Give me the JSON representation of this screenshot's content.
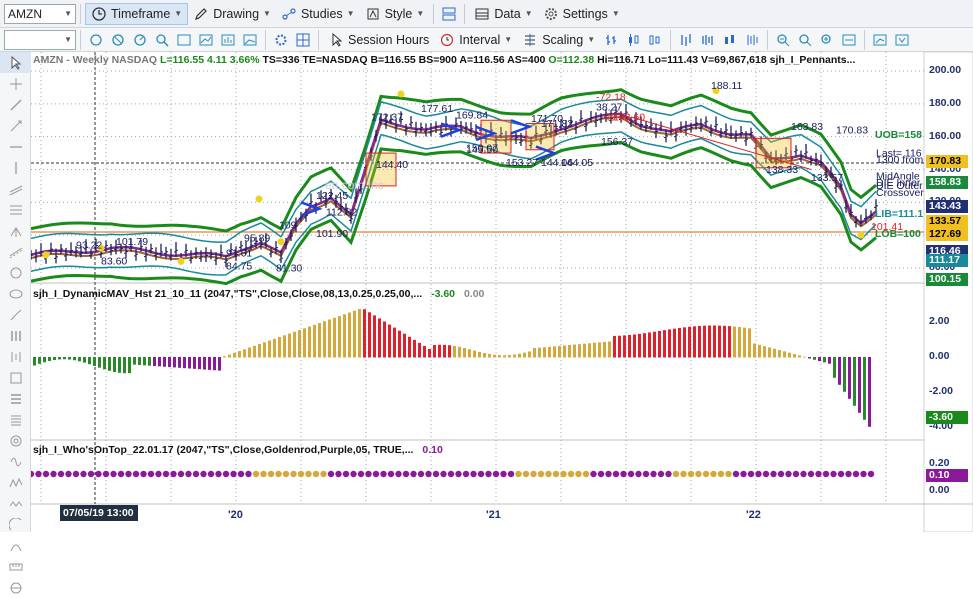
{
  "toolbar": {
    "symbol": "AMZN",
    "timeframe": "Timeframe",
    "drawing": "Drawing",
    "studies": "Studies",
    "style": "Style",
    "data": "Data",
    "settings": "Settings"
  },
  "toolbar2": {
    "session_hours": "Session Hours",
    "interval": "Interval",
    "scaling": "Scaling"
  },
  "price_pane": {
    "title_sym": "AMZN - Weekly  NASDAQ",
    "title_L": "L=116.55",
    "title_chg": "4.11",
    "title_pct": "3.66%",
    "title_rest": "TS=336  TE=NASDAQ  B=116.55  BS=900  A=116.56  AS=400",
    "title_O": "O=112.38",
    "title_rest2": "Hi=116.71  Lo=111.43  V=69,867,618  sjh_I_Pennants...",
    "watermark": "en.com Inc",
    "axis": [
      "200.00",
      "180.00",
      "160.00",
      "140.00",
      "120.00",
      "100.00",
      "80.00"
    ],
    "annotations": [
      "93.22",
      "101.79",
      "83.60",
      "84.75",
      "91.61",
      "95.89",
      "109",
      "122.45",
      "112.82",
      "101.90",
      "81.30",
      "172.37",
      "177.61",
      "169.84",
      "171.70",
      "171.82",
      "150.07",
      "144.40",
      "145.50",
      "153.27",
      "144.06",
      "144.05",
      "156.37",
      "-72.18",
      "38.27",
      "49.76",
      "163.60",
      "188.11",
      "163.83",
      "170.83",
      "138.33",
      "133.57",
      "101.41",
      "MidAngle",
      "DIE Inner",
      "DIE Outer",
      "Crossover",
      "Last= 116",
      "1300 from"
    ],
    "right_tags": [
      {
        "text": "UOB=158",
        "color": "#1a8a3a"
      },
      {
        "text": "LIB=111.1",
        "color": "#1a8a9a"
      },
      {
        "text": "LOB=100",
        "color": "#1a8a3a"
      }
    ],
    "price_tags": [
      {
        "value": "170.83",
        "bg": "#f0c020",
        "fg": "#000"
      },
      {
        "value": "158.83",
        "bg": "#1a8a3a",
        "fg": "#fff"
      },
      {
        "value": "143.43",
        "bg": "#203070",
        "fg": "#fff"
      },
      {
        "value": "133.57",
        "bg": "#f0c020",
        "fg": "#000"
      },
      {
        "value": "127.69",
        "bg": "#f0c020",
        "fg": "#000"
      },
      {
        "value": "116.46",
        "bg": "#203070",
        "fg": "#fff"
      },
      {
        "value": "111.17",
        "bg": "#1a8a9a",
        "fg": "#fff"
      },
      {
        "value": "100.15",
        "bg": "#1a8a3a",
        "fg": "#fff"
      }
    ]
  },
  "mav_pane": {
    "title": "sjh_I_DynamicMAV_Hst 21_10_11 (2047,\"TS\",Close,Close,08,13,0.25,0.25,00,...",
    "value1": "-3.60",
    "value2": "0.00",
    "axis": [
      "2.00",
      "0.00",
      "-2.00",
      "-4.00"
    ],
    "tag": "-3.60"
  },
  "who_pane": {
    "title": "sjh_I_Who'sOnTop_22.01.17 (2047,\"TS\",Close,Goldenrod,Purple,05, TRUE,...",
    "value": "0.10",
    "axis": [
      "0.20",
      "0.00"
    ],
    "tag": "0.10"
  },
  "time_axis": {
    "cursor_label": "07/05/19 13:00",
    "labels": [
      "'20",
      "'21",
      "'22"
    ]
  },
  "colors": {
    "band_outer": "#1a8a1a",
    "band_inner": "#1a8a9a",
    "mid": "#8a2a8a",
    "hist_gold": "#d4a83a",
    "hist_red": "#e0202a",
    "hist_green": "#2a8a2a",
    "hist_purple": "#8a1a9a"
  }
}
